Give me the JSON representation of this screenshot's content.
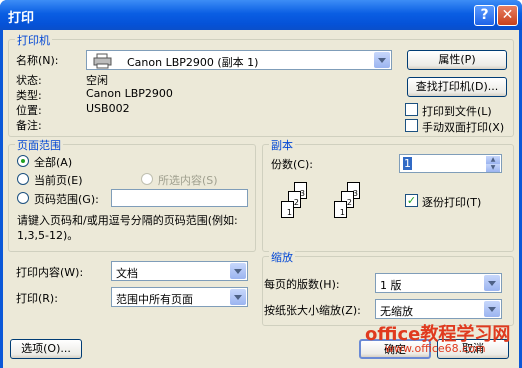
{
  "window": {
    "title": "打印"
  },
  "printer": {
    "legend": "打印机",
    "name_label": "名称(N):",
    "name_value": "Canon LBP2900 (副本 1)",
    "properties_button": "属性(P)",
    "status_label": "状态:",
    "status_value": "空闲",
    "type_label": "类型:",
    "type_value": "Canon LBP2900",
    "location_label": "位置:",
    "location_value": "USB002",
    "comment_label": "备注:",
    "find_button": "查找打印机(D)...",
    "print_to_file": "打印到文件(L)",
    "manual_duplex": "手动双面打印(X)"
  },
  "page_range": {
    "legend": "页面范围",
    "all": "全部(A)",
    "current": "当前页(E)",
    "selection": "所选内容(S)",
    "pages": "页码范围(G):",
    "hint": "请键入页码和/或用逗号分隔的页码范围(例如: 1,3,5-12)。"
  },
  "copies": {
    "legend": "副本",
    "count_label": "份数(C):",
    "count_value": "1",
    "collate": "逐份打印(T)"
  },
  "print_what": {
    "content_label": "打印内容(W):",
    "content_value": "文档",
    "print_label": "打印(R):",
    "print_value": "范围中所有页面"
  },
  "zoom": {
    "legend": "缩放",
    "pages_per_sheet_label": "每页的版数(H):",
    "pages_per_sheet_value": "1 版",
    "scale_label": "按纸张大小缩放(Z):",
    "scale_value": "无缩放"
  },
  "buttons": {
    "options": "选项(O)...",
    "ok": "确定",
    "cancel": "取消"
  },
  "watermark": {
    "line1": "office教程学习网",
    "line2": "www.office68.com"
  }
}
